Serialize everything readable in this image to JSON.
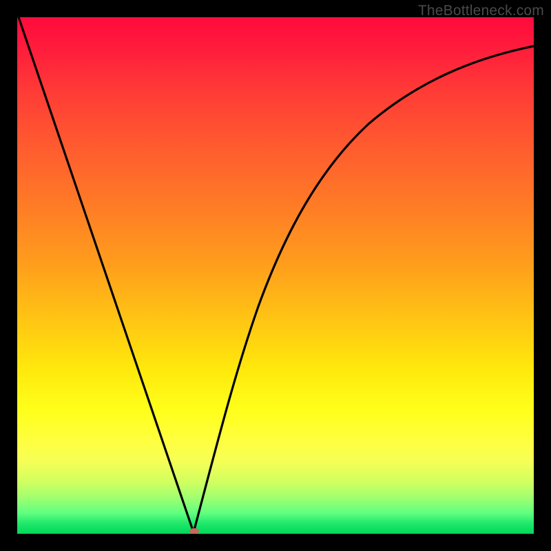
{
  "watermark": "TheBottleneck.com",
  "marker_color": "#c46a5e",
  "chart_data": {
    "type": "line",
    "title": "",
    "xlabel": "",
    "ylabel": "",
    "xlim": [
      0,
      100
    ],
    "ylim": [
      0,
      100
    ],
    "series": [
      {
        "name": "bottleneck-curve",
        "x": [
          0,
          5,
          10,
          15,
          20,
          25,
          30,
          34.3,
          38,
          42,
          46,
          50,
          55,
          60,
          65,
          70,
          75,
          80,
          85,
          90,
          95,
          100
        ],
        "values": [
          100,
          87,
          73,
          58,
          43,
          28,
          14,
          0,
          15,
          29,
          41,
          51,
          60,
          67,
          73,
          78,
          82,
          85,
          88,
          90,
          91,
          92
        ]
      }
    ],
    "annotations": [
      {
        "name": "minimum-marker",
        "x": 34.3,
        "y": 0
      }
    ],
    "background_gradient": {
      "top": "#ff0a3c",
      "mid": "#ffe80c",
      "bottom": "#00d85a"
    }
  }
}
